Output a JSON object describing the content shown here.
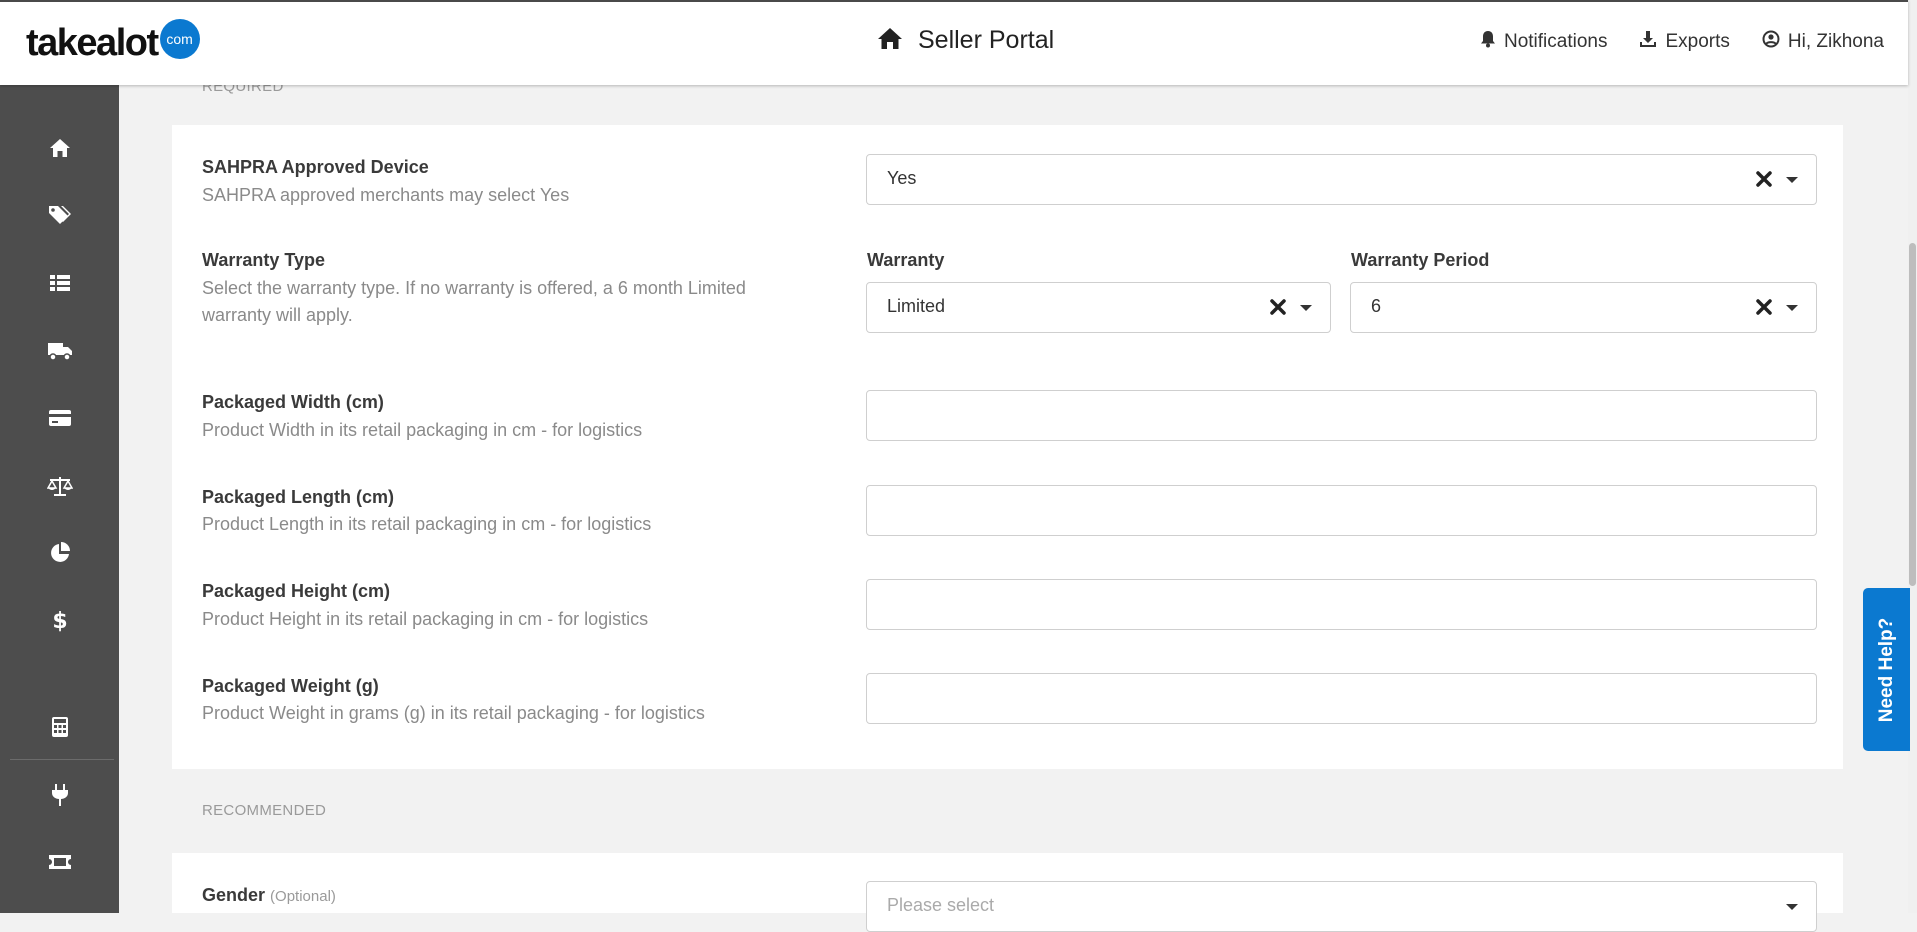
{
  "header": {
    "logo_text": "takealot",
    "logo_badge": "com",
    "portal_title": "Seller Portal",
    "nav": [
      {
        "label": "Notifications",
        "icon": "bell-icon"
      },
      {
        "label": "Exports",
        "icon": "download-icon"
      },
      {
        "label": "Hi, Zikhona",
        "icon": "user-circle-icon"
      }
    ]
  },
  "sidebar": {
    "items": [
      "home-icon",
      "tags-icon",
      "list-icon",
      "truck-icon",
      "credit-card-icon",
      "scale-icon",
      "pie-chart-icon",
      "dollar-icon",
      "calculator-icon",
      "plug-icon",
      "ticket-icon"
    ]
  },
  "sections": {
    "required_label": "REQUIRED",
    "recommended_label": "RECOMMENDED"
  },
  "fields": {
    "sahpra": {
      "title": "SAHPRA Approved Device",
      "desc": "SAHPRA approved merchants may select Yes",
      "value": "Yes"
    },
    "warranty": {
      "title": "Warranty Type",
      "desc": "Select the warranty type. If no warranty is offered, a 6 month Limited warranty will apply.",
      "type_label": "Warranty",
      "type_value": "Limited",
      "period_label": "Warranty Period",
      "period_value": "6"
    },
    "width": {
      "title": "Packaged Width (cm)",
      "desc": "Product Width in its retail packaging in cm - for logistics",
      "value": ""
    },
    "length": {
      "title": "Packaged Length (cm)",
      "desc": "Product Length in its retail packaging in cm - for logistics",
      "value": ""
    },
    "height": {
      "title": "Packaged Height (cm)",
      "desc": "Product Height in its retail packaging in cm - for logistics",
      "value": ""
    },
    "weight": {
      "title": "Packaged Weight (g)",
      "desc": "Product Weight in grams (g) in its retail packaging - for logistics",
      "value": ""
    },
    "gender": {
      "title": "Gender",
      "optional": "(Optional)",
      "placeholder": "Please select"
    }
  },
  "help_button": "Need Help?"
}
